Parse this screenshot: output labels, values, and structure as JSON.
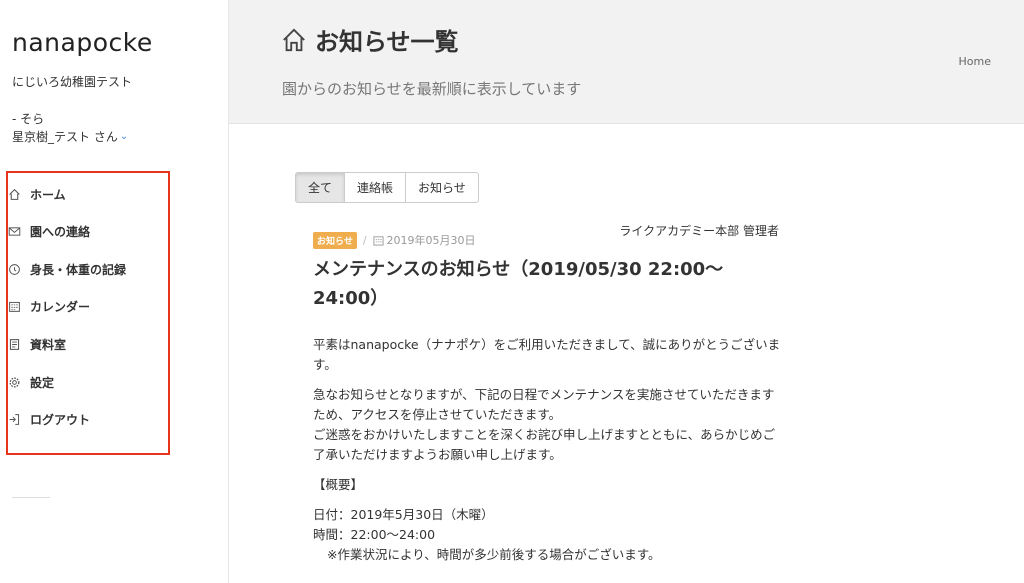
{
  "sidebar": {
    "logo": "nanapocke",
    "school": "にじいろ幼稚園テスト",
    "child": "- そら",
    "user": "星京樹_テスト さん",
    "items": [
      {
        "label": "ホーム",
        "icon": "home-icon"
      },
      {
        "label": "園への連絡",
        "icon": "mail-icon"
      },
      {
        "label": "身長・体重の記録",
        "icon": "record-icon"
      },
      {
        "label": "カレンダー",
        "icon": "calendar-icon"
      },
      {
        "label": "資料室",
        "icon": "document-icon"
      },
      {
        "label": "設定",
        "icon": "gear-icon"
      },
      {
        "label": "ログアウト",
        "icon": "logout-icon"
      }
    ],
    "highlight_color": "#e8341c"
  },
  "header": {
    "title": "お知らせ一覧",
    "subtitle": "園からのお知らせを最新順に表示しています",
    "breadcrumb": "Home"
  },
  "tabs": [
    {
      "label": "全て",
      "active": true
    },
    {
      "label": "連絡帳",
      "active": false
    },
    {
      "label": "お知らせ",
      "active": false
    }
  ],
  "article": {
    "badge": "お知らせ",
    "date": "2019年05月30日",
    "author": "ライクアカデミー本部 管理者",
    "title": "メンテナンスのお知らせ（2019/05/30 22:00〜24:00）",
    "p1": "平素はnanapocke（ナナポケ）をご利用いただきまして、誠にありがとうございます。",
    "p2a": "急なお知らせとなりますが、下記の日程でメンテナンスを実施させていただきますため、アクセスを停止させていただきます。",
    "p2b": "ご迷惑をおかけいたしますことを深くお詫び申し上げますとともに、あらかじめご了承いただけますようお願い申し上げます。",
    "section": "【概要】",
    "line_date": "日付：2019年5月30日（木曜）",
    "line_time": "時間：22:00〜24:00",
    "note": "※作業状況により、時間が多少前後する場合がございます。",
    "badge_color": "#f0ad4e"
  }
}
